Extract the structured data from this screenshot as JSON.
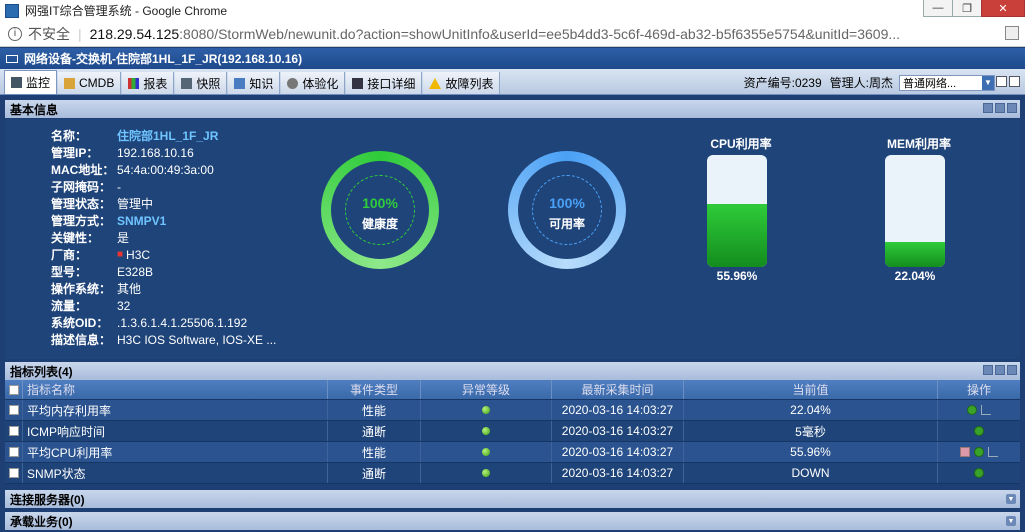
{
  "window": {
    "title": "网强IT综合管理系统 - Google Chrome",
    "buttons": [
      "—",
      "❐",
      "✕"
    ]
  },
  "address": {
    "insecure_label": "不安全",
    "separator": "|",
    "host": "218.29.54.125",
    "path": ":8080/StormWeb/newunit.do?action=showUnitInfo&userId=ee5b4dd3-5c6f-469d-ab32-b5f6355e5754&unitId=3609..."
  },
  "app": {
    "title": "网络设备-交换机-住院部1HL_1F_JR(192.168.10.16)"
  },
  "tabs": [
    {
      "label": "监控",
      "icon": "monitor-icon",
      "active": true
    },
    {
      "label": "CMDB",
      "icon": "database-icon",
      "active": false
    },
    {
      "label": "报表",
      "icon": "report-icon",
      "active": false
    },
    {
      "label": "快照",
      "icon": "snapshot-icon",
      "active": false
    },
    {
      "label": "知识",
      "icon": "knowledge-icon",
      "active": false
    },
    {
      "label": "体验化",
      "icon": "experience-icon",
      "active": false
    },
    {
      "label": "接口详细",
      "icon": "interface-icon",
      "active": false
    },
    {
      "label": "故障列表",
      "icon": "warning-icon",
      "active": false
    }
  ],
  "asset": {
    "number_text": "资产编号:0239",
    "manager_text": "管理人:周杰",
    "select_value": "普通网络..."
  },
  "basic": {
    "header": "基本信息",
    "props": [
      {
        "label": "名称：",
        "value": "住院部1HL_1F_JR",
        "link": true
      },
      {
        "label": "管理IP：",
        "value": "192.168.10.16",
        "link": false
      },
      {
        "label": "MAC地址：",
        "value": "54:4a:00:49:3a:00",
        "link": false
      },
      {
        "label": "子网掩码：",
        "value": "-",
        "link": false
      },
      {
        "label": "管理状态：",
        "value": "管理中",
        "link": false
      },
      {
        "label": "管理方式：",
        "value": "SNMPV1",
        "link": true
      },
      {
        "label": "关键性：",
        "value": "是",
        "link": false
      },
      {
        "label": "厂商：",
        "value": "H3C",
        "link": false
      },
      {
        "label": "型号：",
        "value": "E328B",
        "link": false
      },
      {
        "label": "操作系统：",
        "value": "其他",
        "link": false
      },
      {
        "label": "流量：",
        "value": "32",
        "link": false
      },
      {
        "label": "系统OID：",
        "value": ".1.3.6.1.4.1.25506.1.192",
        "link": false
      },
      {
        "label": "描述信息：",
        "value": "H3C IOS Software, IOS-XE ...",
        "link": false
      }
    ],
    "health": {
      "value": "100%",
      "label": "健康度"
    },
    "availability": {
      "value": "100%",
      "label": "可用率"
    },
    "cpu": {
      "title": "CPU利用率",
      "value": "55.96%",
      "level": 0.5596
    },
    "mem": {
      "title": "MEM利用率",
      "value": "22.04%",
      "level": 0.2204
    }
  },
  "metrics": {
    "header": "指标列表(4)",
    "columns": [
      "指标名称",
      "事件类型",
      "异常等级",
      "最新采集时间",
      "当前值",
      "操作"
    ],
    "rows": [
      {
        "name": "平均内存利用率",
        "type": "性能",
        "time": "2020-03-16 14:03:27",
        "value": "22.04%"
      },
      {
        "name": "ICMP响应时间",
        "type": "通断",
        "time": "2020-03-16 14:03:27",
        "value": "5毫秒"
      },
      {
        "name": "平均CPU利用率",
        "type": "性能",
        "time": "2020-03-16 14:03:27",
        "value": "55.96%"
      },
      {
        "name": "SNMP状态",
        "type": "通断",
        "time": "2020-03-16 14:03:27",
        "value": "DOWN"
      }
    ]
  },
  "sections": {
    "connected_servers": "连接服务器(0)",
    "hosted_business": "承载业务(0)"
  },
  "colors": {
    "health": "#2fcb3a",
    "availability": "#4aa0f5",
    "background": "#1d3f74"
  }
}
